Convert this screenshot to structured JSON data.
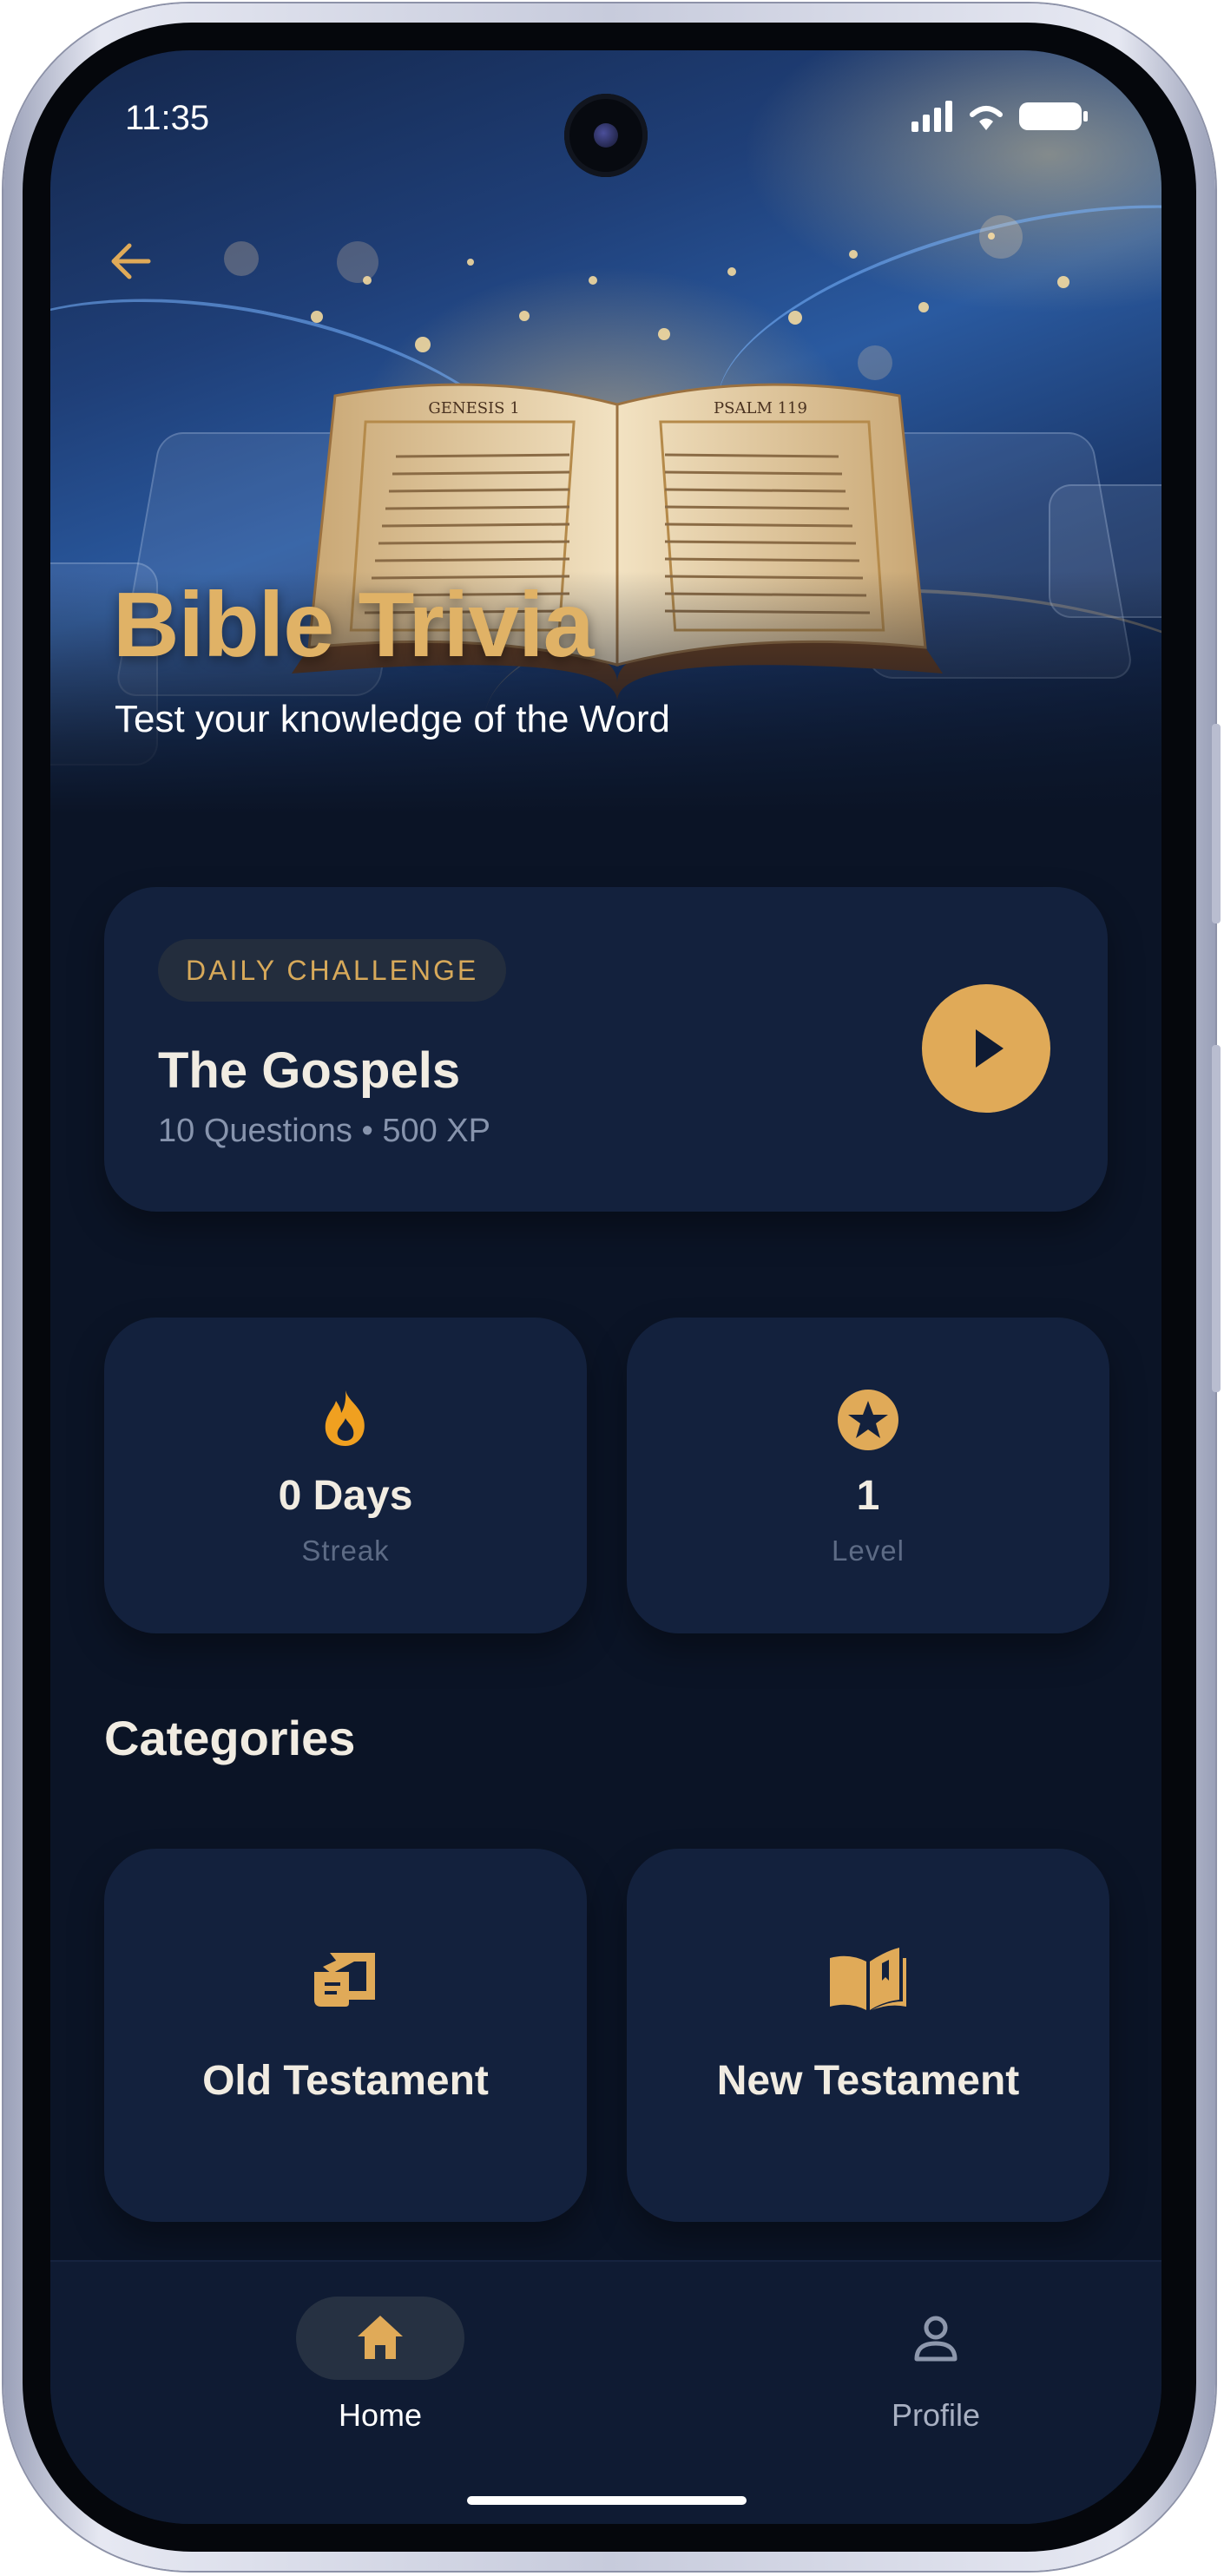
{
  "status_bar": {
    "time": "11:35"
  },
  "hero": {
    "title": "Bible Trivia",
    "subtitle": "Test your knowledge of the Word",
    "book_left_page": "GENESIS 1",
    "book_right_page": "PSALM 119"
  },
  "daily_challenge": {
    "badge": "DAILY CHALLENGE",
    "title": "The Gospels",
    "meta": "10 Questions • 500 XP"
  },
  "stats": [
    {
      "value": "0 Days",
      "label": "Streak",
      "icon": "flame-icon"
    },
    {
      "value": "1",
      "label": "Level",
      "icon": "star-badge-icon"
    }
  ],
  "categories": {
    "title": "Categories",
    "items": [
      {
        "label": "Old Testament",
        "icon": "scroll-icon"
      },
      {
        "label": "New Testament",
        "icon": "open-book-icon"
      }
    ]
  },
  "bottom_nav": {
    "items": [
      {
        "label": "Home",
        "icon": "home-icon",
        "active": true
      },
      {
        "label": "Profile",
        "icon": "person-icon",
        "active": false
      }
    ]
  },
  "colors": {
    "accent_gold": "#e0aa58",
    "background": "#0b1426",
    "card": "#13213d",
    "flame_orange": "#f0a020"
  }
}
